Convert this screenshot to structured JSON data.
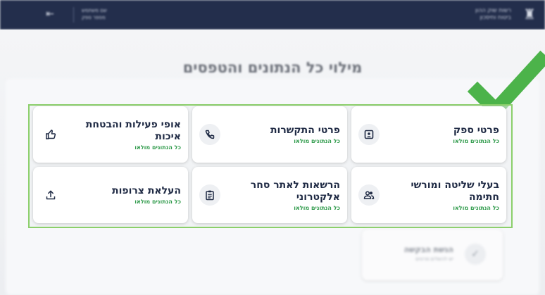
{
  "topbar": {
    "logo_line1": "רשות שוק ההון",
    "logo_line2": "ביטוח וחיסכון",
    "user_line1": "שם משתמש",
    "user_line2": "מספר ספק"
  },
  "page": {
    "heading": "מילוי כל הנתונים והטפסים"
  },
  "tiles": [
    {
      "title": "פרטי ספק",
      "status": "כל הנתונים מולאו",
      "icon": "badge-icon"
    },
    {
      "title": "פרטי התקשרות",
      "status": "כל הנתונים מולאו",
      "icon": "phone-icon"
    },
    {
      "title": "אופי פעילות והבטחת איכות",
      "status": "כל הנתונים מולאו",
      "icon": "thumbs-up-icon"
    },
    {
      "title": "בעלי שליטה ומורשי חתימה",
      "status": "כל הנתונים מולאו",
      "icon": "people-icon"
    },
    {
      "title": "הרשאות לאתר סחר אלקטרוני",
      "status": "כל הנתונים מולאו",
      "icon": "clipboard-icon"
    },
    {
      "title": "העלאת צרופות",
      "status": "כל הנתונים מולאו",
      "icon": "upload-icon"
    }
  ],
  "submit": {
    "title": "הגשת הבקשה",
    "subtitle": "יש להשלים פרטים"
  },
  "colors": {
    "navy": "#232e4c",
    "success_green": "#2e9a4a",
    "check_green": "#4cb34a",
    "frame_green": "#8bcf6a"
  }
}
